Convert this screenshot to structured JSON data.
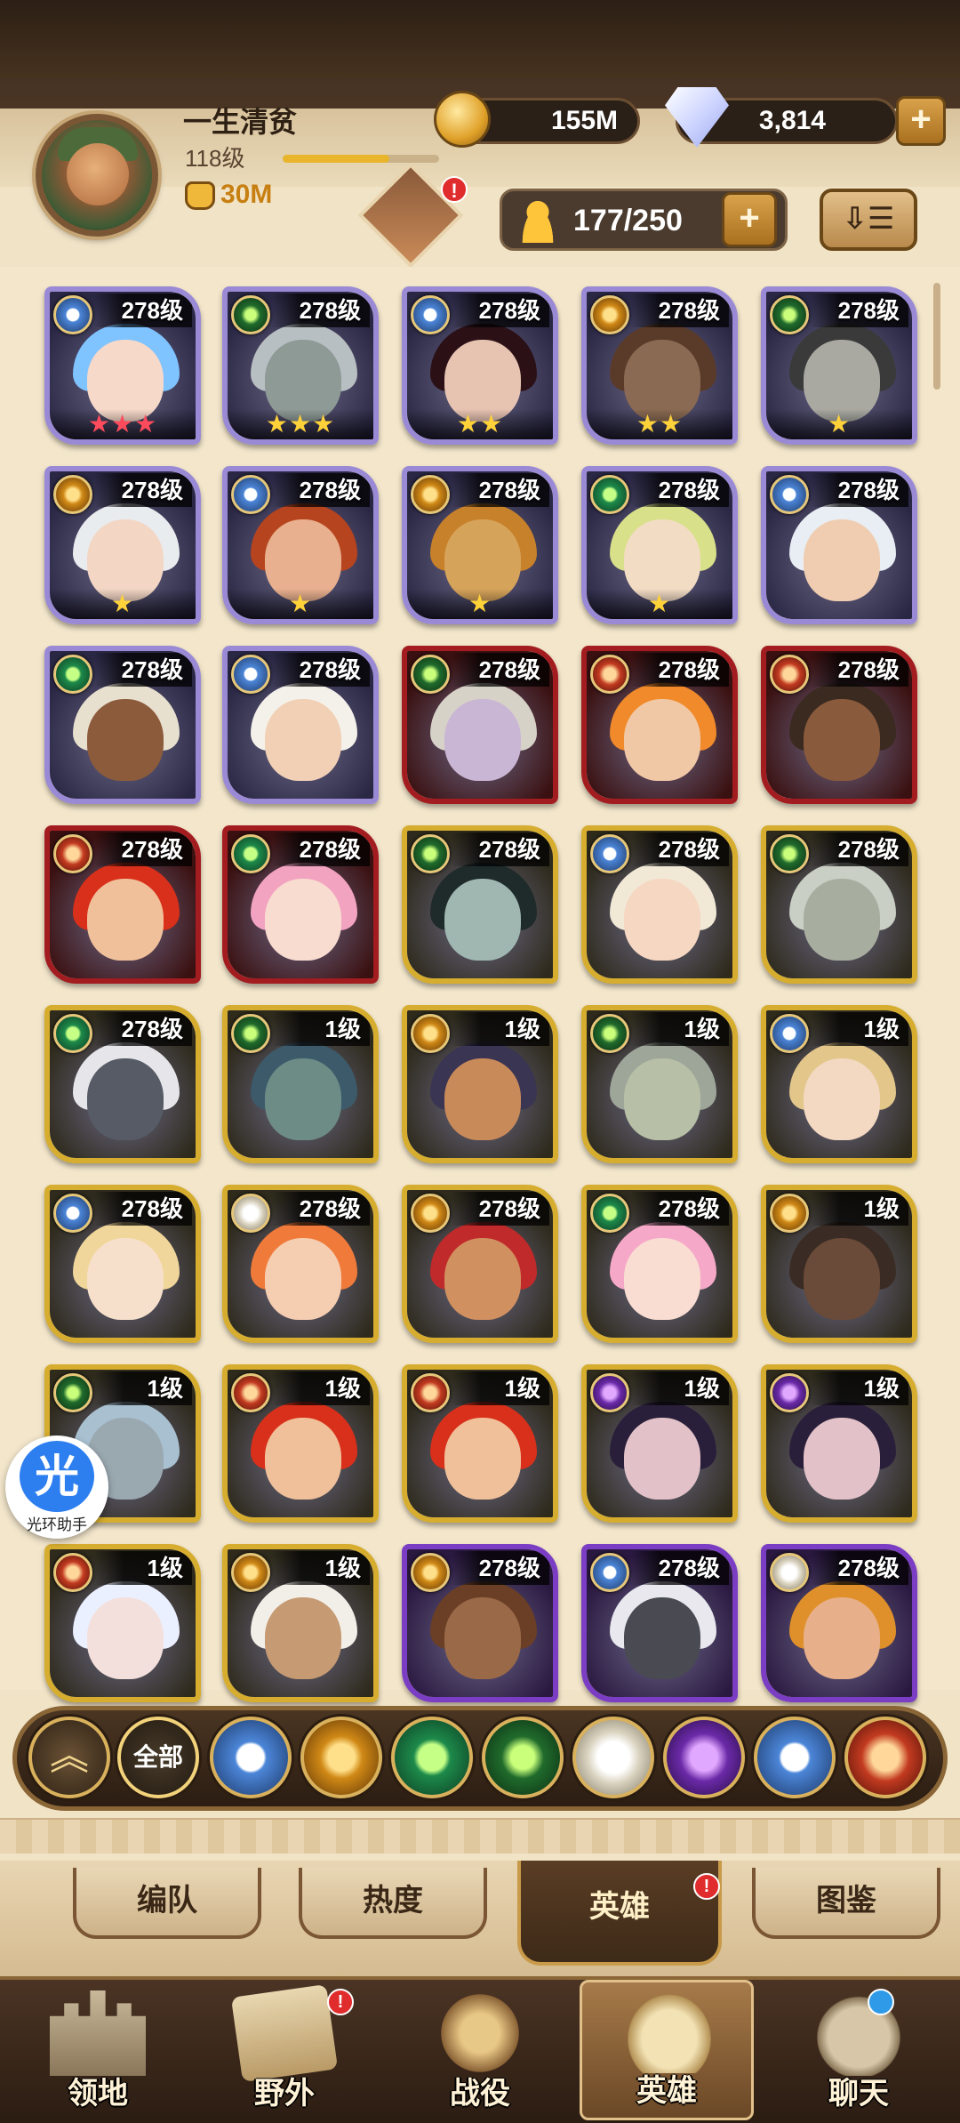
{
  "player": {
    "name": "一生清贫",
    "level": "118级",
    "exp_fraction": 0.68,
    "power": "30M"
  },
  "resources": {
    "gold": "155M",
    "diamonds": "3,814",
    "hero_slots": "177/250"
  },
  "badges": {
    "event": "!",
    "hero_tab": "!",
    "wild_tab": "!"
  },
  "buttons": {
    "plus": "+",
    "sort": "⇩☰"
  },
  "colors": {
    "purple_frame": "#9a8ad6",
    "red_frame": "#a31c20",
    "gold_frame": "#d6ad2e",
    "violet_frame": "#7a3dc4",
    "panel_bg": "#f3e6cb",
    "nav_bg": "#2b1c12"
  },
  "heroes": [
    {
      "level": "278级",
      "faction": "light",
      "frame": "purple",
      "stars": "★★★",
      "star_color": "red",
      "hair": "#7fc3ff",
      "skin": "#f7d9c9"
    },
    {
      "level": "278级",
      "faction": "graveborn",
      "frame": "purple",
      "stars": "★★★",
      "star_color": "gold",
      "hair": "#b8bfc2",
      "skin": "#8e9a96"
    },
    {
      "level": "278级",
      "faction": "light",
      "frame": "purple",
      "stars": "★★",
      "star_color": "gold",
      "hair": "#2b1016",
      "skin": "#e7c3b2"
    },
    {
      "level": "278级",
      "faction": "mauler",
      "frame": "purple",
      "stars": "★★",
      "star_color": "gold",
      "hair": "#5a3b2a",
      "skin": "#8a6a52"
    },
    {
      "level": "278级",
      "faction": "graveborn",
      "frame": "purple",
      "stars": "★",
      "star_color": "gold",
      "hair": "#3a3a3a",
      "skin": "#a9a9a2"
    },
    {
      "level": "278级",
      "faction": "mauler",
      "frame": "purple",
      "stars": "★",
      "star_color": "gold",
      "hair": "#e9ecef",
      "skin": "#f3d6c4"
    },
    {
      "level": "278级",
      "faction": "light",
      "frame": "purple",
      "stars": "★",
      "star_color": "gold",
      "hair": "#b6441f",
      "skin": "#e8b08e"
    },
    {
      "level": "278级",
      "faction": "mauler",
      "frame": "purple",
      "stars": "★",
      "star_color": "gold",
      "hair": "#c7812a",
      "skin": "#d6a35a"
    },
    {
      "level": "278级",
      "faction": "wild",
      "frame": "purple",
      "stars": "★",
      "star_color": "gold",
      "hair": "#d9e08a",
      "skin": "#f2dcc4"
    },
    {
      "level": "278级",
      "faction": "light",
      "frame": "purple",
      "stars": "",
      "star_color": "gold",
      "hair": "#e8eef4",
      "skin": "#f0cdb0"
    },
    {
      "level": "278级",
      "faction": "wild",
      "frame": "purple",
      "stars": "",
      "star_color": "gold",
      "hair": "#e8e0cf",
      "skin": "#8c5b3c"
    },
    {
      "level": "278级",
      "faction": "light",
      "frame": "purple",
      "stars": "",
      "star_color": "gold",
      "hair": "#f4f1ea",
      "skin": "#f1d0b5"
    },
    {
      "level": "278级",
      "faction": "graveborn",
      "frame": "red",
      "stars": "",
      "star_color": "gold",
      "hair": "#d7d2c8",
      "skin": "#c9b6d4"
    },
    {
      "level": "278级",
      "faction": "dimensional",
      "frame": "red",
      "stars": "",
      "star_color": "gold",
      "hair": "#f08a2a",
      "skin": "#f1c8a6"
    },
    {
      "level": "278级",
      "faction": "dimensional",
      "frame": "red",
      "stars": "",
      "star_color": "gold",
      "hair": "#3b2a20",
      "skin": "#8a5a3c"
    },
    {
      "level": "278级",
      "faction": "dimensional",
      "frame": "red",
      "stars": "",
      "star_color": "gold",
      "hair": "#d8301a",
      "skin": "#f0c09a"
    },
    {
      "level": "278级",
      "faction": "wild",
      "frame": "red",
      "stars": "",
      "star_color": "gold",
      "hair": "#f2a3c0",
      "skin": "#f8dcd0"
    },
    {
      "level": "278级",
      "faction": "graveborn",
      "frame": "gold",
      "stars": "",
      "star_color": "gold",
      "hair": "#1f2a2a",
      "skin": "#9fb7b0"
    },
    {
      "level": "278级",
      "faction": "light",
      "frame": "gold",
      "stars": "",
      "star_color": "gold",
      "hair": "#f1e8d6",
      "skin": "#f5d7c2"
    },
    {
      "level": "278级",
      "faction": "graveborn",
      "frame": "gold",
      "stars": "",
      "star_color": "gold",
      "hair": "#c9cfc4",
      "skin": "#a7ad9f"
    },
    {
      "level": "278级",
      "faction": "wild",
      "frame": "gold",
      "stars": "",
      "star_color": "gold",
      "hair": "#e6e6ea",
      "skin": "#565b66"
    },
    {
      "level": "1级",
      "faction": "graveborn",
      "frame": "gold",
      "stars": "",
      "star_color": "gold",
      "hair": "#3c5a6a",
      "skin": "#6d8c86"
    },
    {
      "level": "1级",
      "faction": "mauler",
      "frame": "gold",
      "stars": "",
      "star_color": "gold",
      "hair": "#3a3552",
      "skin": "#c98a5a"
    },
    {
      "level": "1级",
      "faction": "graveborn",
      "frame": "gold",
      "stars": "",
      "star_color": "gold",
      "hair": "#9ea69a",
      "skin": "#b7c0a6"
    },
    {
      "level": "1级",
      "faction": "light",
      "frame": "gold",
      "stars": "",
      "star_color": "gold",
      "hair": "#e2c68a",
      "skin": "#f3d8c2"
    },
    {
      "level": "278级",
      "faction": "light",
      "frame": "gold",
      "stars": "",
      "star_color": "gold",
      "hair": "#f0d69a",
      "skin": "#f6e0cc"
    },
    {
      "level": "278级",
      "faction": "celestial",
      "frame": "gold",
      "stars": "",
      "star_color": "gold",
      "hair": "#f07a3a",
      "skin": "#f5cdb0"
    },
    {
      "level": "278级",
      "faction": "mauler",
      "frame": "gold",
      "stars": "",
      "star_color": "gold",
      "hair": "#c12a2a",
      "skin": "#d09060"
    },
    {
      "level": "278级",
      "faction": "wild",
      "frame": "gold",
      "stars": "",
      "star_color": "gold",
      "hair": "#f6a8c8",
      "skin": "#f9ddd2"
    },
    {
      "level": "1级",
      "faction": "mauler",
      "frame": "gold",
      "stars": "",
      "star_color": "gold",
      "hair": "#3a2c24",
      "skin": "#6a4a38"
    },
    {
      "level": "1级",
      "faction": "graveborn",
      "frame": "gold",
      "stars": "",
      "star_color": "gold",
      "hair": "#a8c0d0",
      "skin": "#9aa8b0"
    },
    {
      "level": "1级",
      "faction": "dimensional",
      "frame": "gold",
      "stars": "",
      "star_color": "gold",
      "hair": "#d8301a",
      "skin": "#f0c09a"
    },
    {
      "level": "1级",
      "faction": "dimensional",
      "frame": "gold",
      "stars": "",
      "star_color": "gold",
      "hair": "#d8301a",
      "skin": "#f0c09a"
    },
    {
      "level": "1级",
      "faction": "hypogean",
      "frame": "gold",
      "stars": "",
      "star_color": "gold",
      "hair": "#2a1f3a",
      "skin": "#e2c2c8"
    },
    {
      "level": "1级",
      "faction": "hypogean",
      "frame": "gold",
      "stars": "",
      "star_color": "gold",
      "hair": "#2a1f3a",
      "skin": "#e2c2c8"
    },
    {
      "level": "1级",
      "faction": "dimensional",
      "frame": "gold",
      "stars": "",
      "star_color": "gold",
      "hair": "#eaf0ff",
      "skin": "#f3e0dc"
    },
    {
      "level": "1级",
      "faction": "mauler",
      "frame": "gold",
      "stars": "",
      "star_color": "gold",
      "hair": "#f2efe8",
      "skin": "#c69a72"
    },
    {
      "level": "278级",
      "faction": "mauler",
      "frame": "violet",
      "stars": "",
      "star_color": "gold",
      "hair": "#6b3f26",
      "skin": "#9a6a48"
    },
    {
      "level": "278级",
      "faction": "light",
      "frame": "violet",
      "stars": "",
      "star_color": "gold",
      "hair": "#e8e8ee",
      "skin": "#4a4a52"
    },
    {
      "level": "278级",
      "faction": "celestial",
      "frame": "violet",
      "stars": "",
      "star_color": "gold",
      "hair": "#e0902a",
      "skin": "#e7b08a"
    }
  ],
  "assistant": {
    "glyph": "光",
    "caption": "光环助手"
  },
  "filters": {
    "up_arrow": "︽",
    "all_label": "全部",
    "factions": [
      "light",
      "mauler",
      "wild",
      "graveborn",
      "celestial",
      "hypogean",
      "dimensional-blue",
      "dimensional"
    ]
  },
  "subtabs": [
    "编队",
    "热度",
    "英雄",
    "图鉴"
  ],
  "nav": [
    "领地",
    "野外",
    "战役",
    "英雄",
    "聊天"
  ]
}
